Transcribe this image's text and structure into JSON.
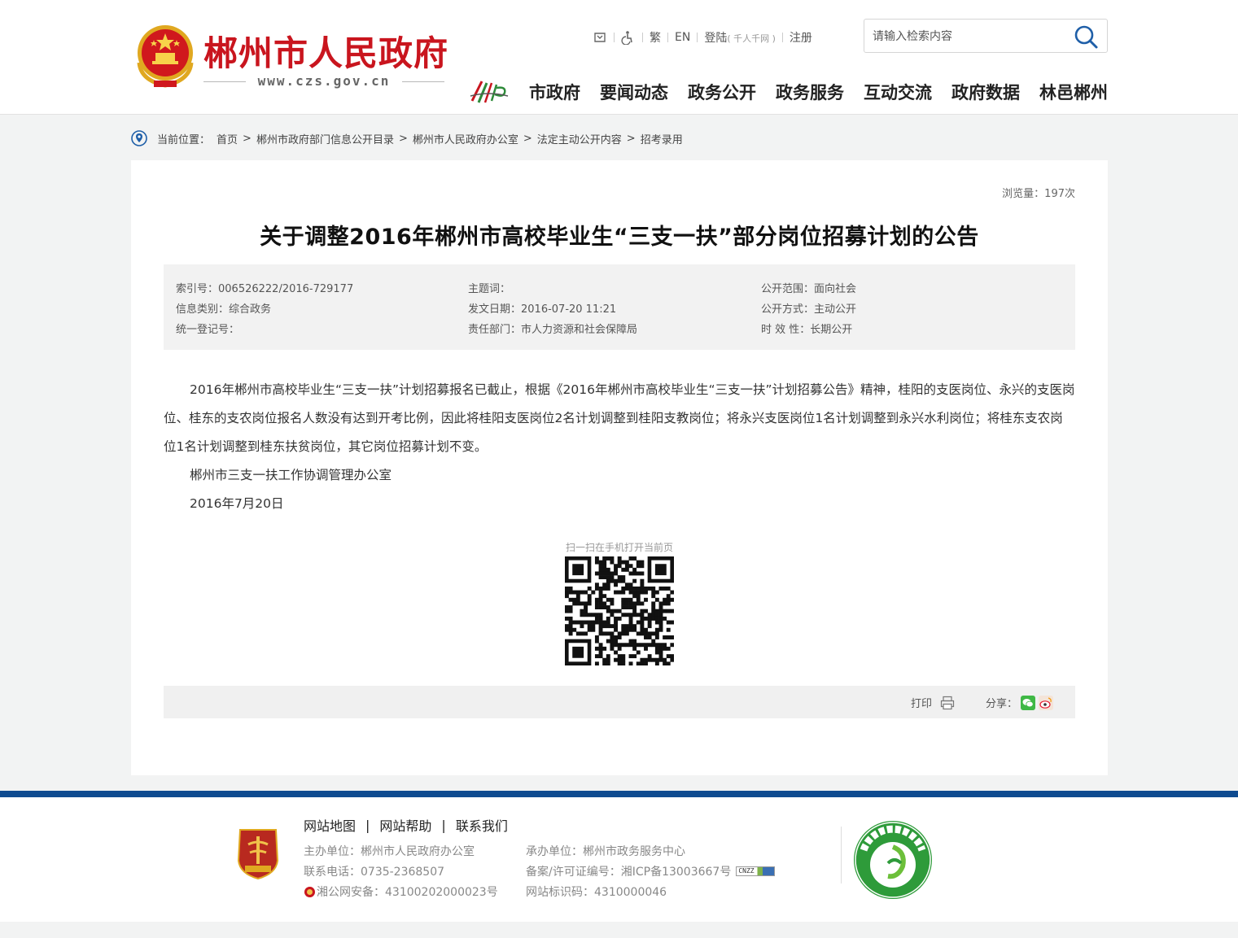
{
  "header": {
    "site_title": "郴州市人民政府",
    "site_url": "www.czs.gov.cn",
    "toplinks": {
      "traditional": "繁",
      "english": "EN",
      "login": "登陆",
      "login_note": "( 千人千网 )",
      "register": "注册"
    },
    "search": {
      "placeholder": "请输入检索内容"
    },
    "nav": [
      "市政府",
      "要闻动态",
      "政务公开",
      "政务服务",
      "互动交流",
      "政府数据",
      "林邑郴州"
    ]
  },
  "breadcrumb": {
    "label": "当前位置：",
    "items": [
      "首页",
      "郴州市政府部门信息公开目录",
      "郴州市人民政府办公室",
      "法定主动公开内容",
      "招考录用"
    ]
  },
  "article": {
    "views": "浏览量：197次",
    "title": "关于调整2016年郴州市高校毕业生“三支一扶”部分岗位招募计划的公告",
    "meta": {
      "index_no": "索引号：006526222/2016-729177",
      "subject": "主题词：",
      "scope": "公开范围：面向社会",
      "category": "信息类别：综合政务",
      "date": "发文日期：2016-07-20 11:21",
      "method": "公开方式：主动公开",
      "reg_no": "统一登记号：",
      "dept": "责任部门：市人力资源和社会保障局",
      "validity": "时 效 性：长期公开"
    },
    "body": "2016年郴州市高校毕业生“三支一扶”计划招募报名已截止，根据《2016年郴州市高校毕业生“三支一扶”计划招募公告》精神，桂阳的支医岗位、永兴的支医岗位、桂东的支农岗位报名人数没有达到开考比例，因此将桂阳支医岗位2名计划调整到桂阳支教岗位；将永兴支医岗位1名计划调整到永兴水利岗位；将桂东支农岗位1名计划调整到桂东扶贫岗位，其它岗位招募计划不变。",
    "signature": "郴州市三支一扶工作协调管理办公室",
    "sign_date": "2016年7月20日",
    "qr_label": "扫一扫在手机打开当前页",
    "print_label": "打印",
    "share_label": "分享："
  },
  "footer": {
    "links": [
      "网站地图",
      "网站帮助",
      "联系我们"
    ],
    "sponsor": "主办单位：郴州市人民政府办公室",
    "phone": "联系电话：0735-2368507",
    "police": "湘公网安备：43100202000023号",
    "operator": "承办单位：郴州市政务服务中心",
    "icp": "备案/许可证编号：湘ICP备13003667号",
    "site_id": "网站标识码：4310000046",
    "cnzz": "CNZZ"
  },
  "colors": {
    "brand_red": "#c9151e",
    "footer_blue": "#0e4b90",
    "search_icon": "#1f5fa8"
  }
}
